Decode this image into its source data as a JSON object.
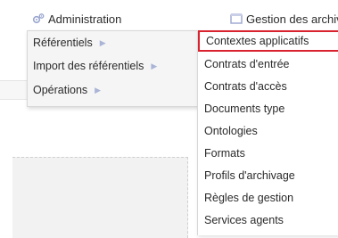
{
  "nav": {
    "admin_label": "Administration",
    "archive_label": "Gestion des archiv",
    "admin_icon": "gears-icon",
    "archive_icon": "archive-icon"
  },
  "submenu": {
    "items": [
      {
        "label": "Référentiels",
        "has_submenu": true
      },
      {
        "label": "Import des référentiels",
        "has_submenu": true
      },
      {
        "label": "Opérations",
        "has_submenu": true
      }
    ]
  },
  "referentiels_menu": {
    "items": [
      {
        "label": "Contextes applicatifs",
        "selected": true
      },
      {
        "label": "Contrats d'entrée"
      },
      {
        "label": "Contrats d'accès"
      },
      {
        "label": "Documents type"
      },
      {
        "label": "Ontologies"
      },
      {
        "label": "Formats"
      },
      {
        "label": "Profils d'archivage"
      },
      {
        "label": "Règles de gestion"
      },
      {
        "label": "Services agents"
      }
    ]
  },
  "colors": {
    "selected_border": "#d9232e",
    "menu_bg": "#f5f5f5",
    "arrow": "#aab4d6"
  }
}
